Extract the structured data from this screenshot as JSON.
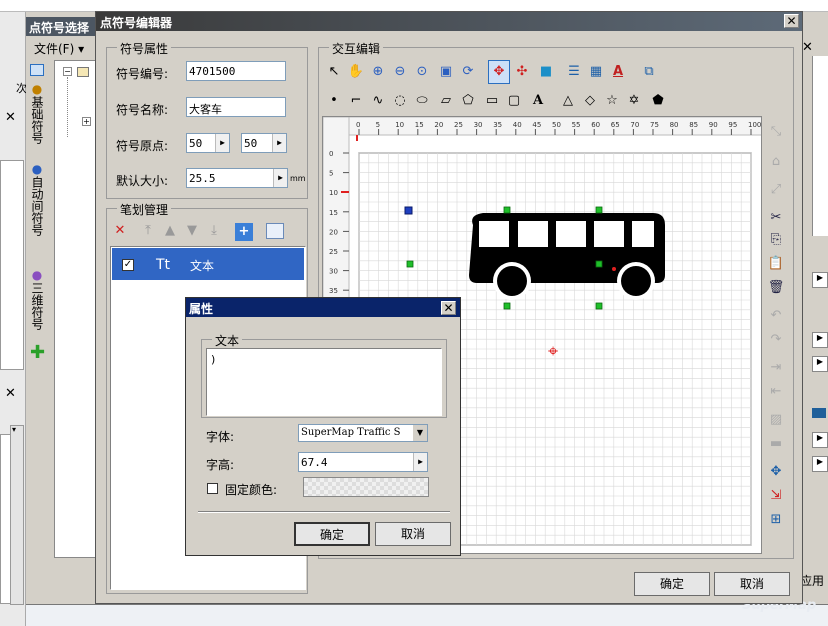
{
  "bg_window": {
    "title": "点符号选择",
    "file_menu": "文件(F)",
    "left_tabs": [
      "基础符号",
      "自动间符号",
      "三维符号"
    ],
    "sidebar_char": "次",
    "apply_label": "应用"
  },
  "editor": {
    "title": "点符号编辑器",
    "props_group": "符号属性",
    "code_label": "符号编号:",
    "code_value": "4701500",
    "name_label": "符号名称:",
    "name_value": "大客车",
    "origin_label": "符号原点:",
    "origin_x": "50",
    "origin_y": "50",
    "size_label": "默认大小:",
    "size_value": "25.5",
    "size_unit": "mm",
    "stroke_group": "笔划管理",
    "stroke_items": [
      {
        "checked": true,
        "icon": "Tt",
        "label": "文本"
      }
    ],
    "interactive_group": "交互编辑",
    "ruler_top": [
      "0",
      "5",
      "10",
      "15",
      "20",
      "25",
      "30",
      "35",
      "40",
      "45",
      "50",
      "55",
      "60",
      "65",
      "70",
      "75",
      "80",
      "85",
      "90",
      "95",
      "100"
    ],
    "ruler_left": [
      "0",
      "5",
      "10",
      "15",
      "20",
      "25",
      "30",
      "35"
    ],
    "ok_label": "确定",
    "cancel_label": "取消"
  },
  "props_dialog": {
    "title": "属性",
    "text_group": "文本",
    "text_value": ")",
    "font_label": "字体:",
    "font_value": "SuperMap Traffic S",
    "height_label": "字高:",
    "height_value": "67.4",
    "fixcolor_label": "固定颜色:",
    "fixcolor_checked": false,
    "ok_label": "确定",
    "cancel_label": "取消"
  },
  "watermark": "SuperMap"
}
